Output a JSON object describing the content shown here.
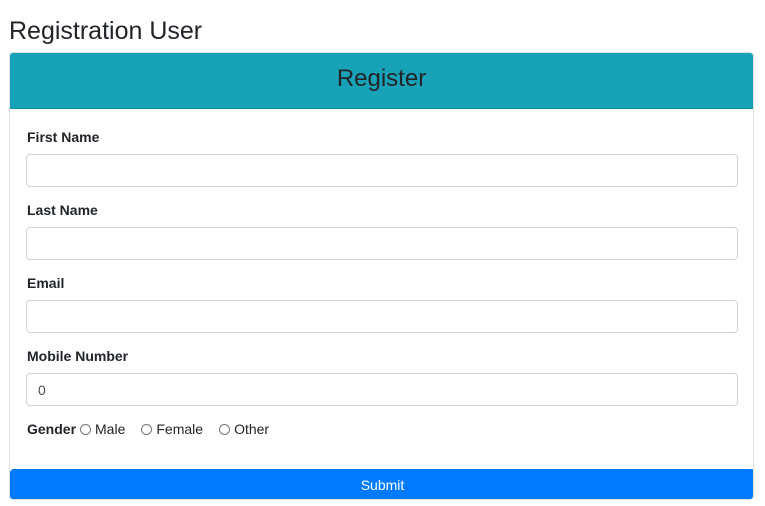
{
  "page": {
    "title": "Registration User"
  },
  "card": {
    "header": "Register"
  },
  "form": {
    "first_name": {
      "label": "First Name",
      "value": ""
    },
    "last_name": {
      "label": "Last Name",
      "value": ""
    },
    "email": {
      "label": "Email",
      "value": ""
    },
    "mobile": {
      "label": "Mobile Number",
      "value": "0"
    },
    "gender": {
      "label": "Gender",
      "options": [
        "Male",
        "Female",
        "Other"
      ],
      "selected": null
    },
    "submit_label": "Submit"
  },
  "colors": {
    "header_bg": "#17a2b8",
    "submit_bg": "#007bff"
  }
}
